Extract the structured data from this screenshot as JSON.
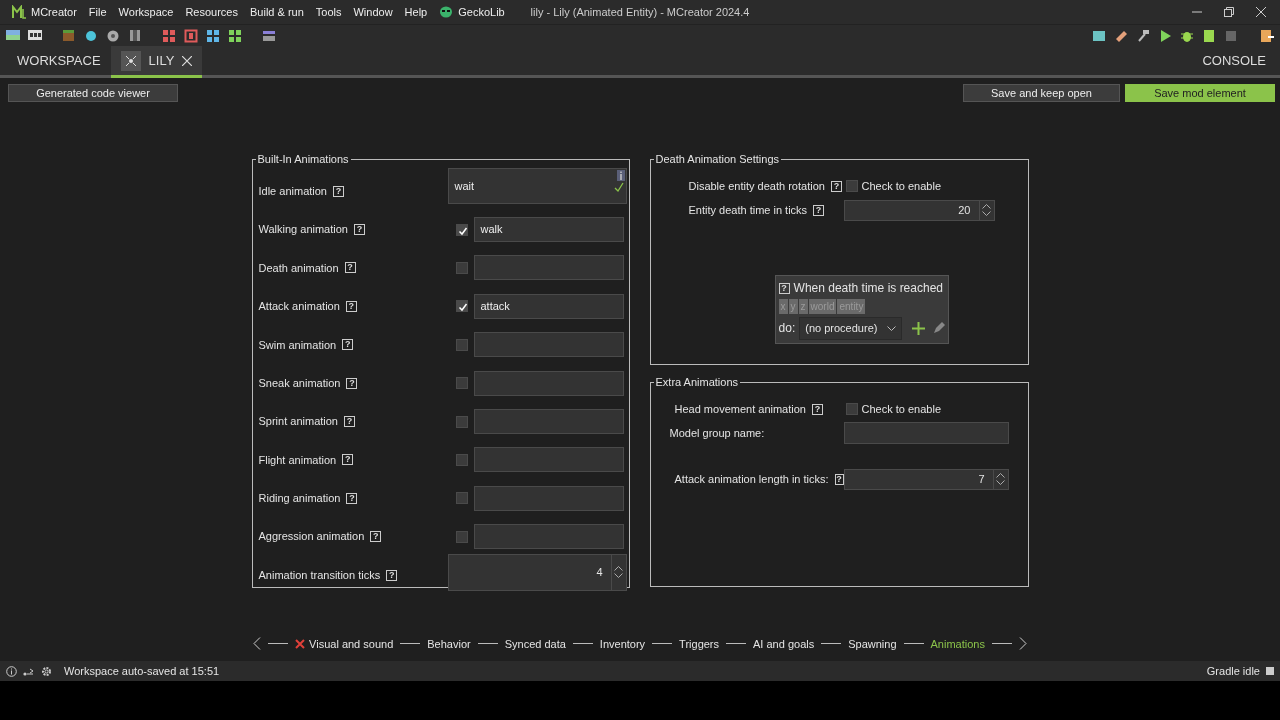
{
  "window": {
    "title": "lily - Lily (Animated Entity) - MCreator 2024.4"
  },
  "menu": [
    {
      "label": "MCreator",
      "kind": "app"
    },
    {
      "label": "File",
      "kind": "plain"
    },
    {
      "label": "Workspace",
      "kind": "plain"
    },
    {
      "label": "Resources",
      "kind": "plain"
    },
    {
      "label": "Build & run",
      "kind": "plain"
    },
    {
      "label": "Tools",
      "kind": "plain"
    },
    {
      "label": "Window",
      "kind": "plain"
    },
    {
      "label": "Help",
      "kind": "plain"
    },
    {
      "label": "GeckoLib",
      "kind": "plugin"
    }
  ],
  "tabs": [
    {
      "label": "WORKSPACE",
      "selected": false,
      "closable": false
    },
    {
      "label": "LILY",
      "selected": true,
      "closable": true
    }
  ],
  "console_tab": {
    "label": "CONSOLE"
  },
  "buttons": {
    "code_viewer": "Generated code viewer",
    "save_open": "Save and keep open",
    "save": "Save mod element"
  },
  "built_in": {
    "title": "Built-In Animations",
    "rows": [
      {
        "label": "Idle animation",
        "help": "?",
        "kind": "text",
        "value": "wait",
        "valid": true
      },
      {
        "label": "Walking animation",
        "help": "?",
        "kind": "toggle",
        "checked": true,
        "value": "walk"
      },
      {
        "label": "Death animation",
        "help": "?",
        "kind": "toggle",
        "checked": false
      },
      {
        "label": "Attack animation",
        "help": "?",
        "kind": "toggle",
        "checked": true,
        "value": "attack"
      },
      {
        "label": "Swim animation",
        "help": "?",
        "kind": "toggle",
        "checked": false
      },
      {
        "label": "Sneak animation",
        "help": "?",
        "kind": "toggle",
        "checked": false
      },
      {
        "label": "Sprint animation",
        "help": "?",
        "kind": "toggle",
        "checked": false
      },
      {
        "label": "Flight animation",
        "help": "?",
        "kind": "toggle",
        "checked": false
      },
      {
        "label": "Riding animation",
        "help": "?",
        "kind": "toggle",
        "checked": false
      },
      {
        "label": "Aggression animation",
        "help": "?",
        "kind": "toggle",
        "checked": false
      },
      {
        "label": "Animation transition ticks",
        "help": "?",
        "kind": "spinner",
        "value": "4"
      }
    ]
  },
  "death": {
    "title": "Death Animation Settings",
    "rotation": {
      "label": "Disable entity death rotation",
      "help": "?",
      "checkbox_label": "Check to enable",
      "checked": false
    },
    "time": {
      "label": "Entity death time in ticks",
      "help": "?",
      "value": "20"
    },
    "procedure": {
      "help": "?",
      "title": "When death time is reached",
      "dependencies": [
        "x",
        "y",
        "z",
        "world",
        "entity"
      ],
      "do_label": "do:",
      "value": "(no procedure)"
    }
  },
  "extra": {
    "title": "Extra Animations",
    "head": {
      "label": "Head movement animation",
      "help": "?",
      "checkbox_label": "Check to enable",
      "checked": false
    },
    "group": {
      "label": "Model group name:"
    },
    "attack_length": {
      "label": "Attack animation length in ticks:",
      "help": "?",
      "value": "7"
    }
  },
  "steps": [
    {
      "label": "Visual and sound",
      "error": true,
      "selected": false
    },
    {
      "label": "Behavior",
      "error": false,
      "selected": false
    },
    {
      "label": "Synced data",
      "error": false,
      "selected": false
    },
    {
      "label": "Inventory",
      "error": false,
      "selected": false
    },
    {
      "label": "Triggers",
      "error": false,
      "selected": false
    },
    {
      "label": "AI and goals",
      "error": false,
      "selected": false
    },
    {
      "label": "Spawning",
      "error": false,
      "selected": false
    },
    {
      "label": "Animations",
      "error": false,
      "selected": true
    }
  ],
  "status_bar": {
    "message": "Workspace auto-saved at 15:51",
    "gradle": "Gradle idle"
  }
}
